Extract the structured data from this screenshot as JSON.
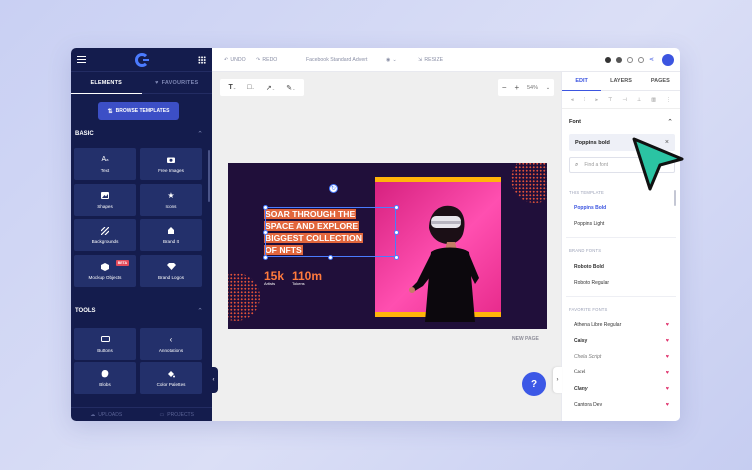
{
  "sidebar": {
    "tabs": {
      "elements": "ELEMENTS",
      "favourites": "FAVOURITES"
    },
    "browse_label": "BROWSE TEMPLATES",
    "basic": {
      "title": "BASIC",
      "items": [
        {
          "label": "Text",
          "icon": "text-icon"
        },
        {
          "label": "Free Images",
          "icon": "camera-icon"
        },
        {
          "label": "Shapes",
          "icon": "shapes-icon"
        },
        {
          "label": "Icons",
          "icon": "star-icon"
        },
        {
          "label": "Backgrounds",
          "icon": "backgrounds-icon"
        },
        {
          "label": "Brand It",
          "icon": "brand-icon"
        },
        {
          "label": "Mockup Objects",
          "icon": "mockup-icon",
          "badge": "BETA"
        },
        {
          "label": "Brand Logos",
          "icon": "diamond-icon"
        }
      ]
    },
    "tools": {
      "title": "TOOLS",
      "items": [
        {
          "label": "Buttons",
          "icon": "button-icon"
        },
        {
          "label": "Annotations",
          "icon": "annotation-icon"
        },
        {
          "label": "Blobs",
          "icon": "blob-icon"
        },
        {
          "label": "Color Palettes",
          "icon": "palette-icon"
        }
      ]
    },
    "bottom": {
      "uploads": "UPLOADS",
      "projects": "PROJECTS"
    }
  },
  "topbar": {
    "undo": "UNDO",
    "redo": "REDO",
    "doc_title": "Facebook Standard Advert",
    "resize": "RESIZE"
  },
  "toolbar": {
    "zoom": "54%"
  },
  "banner": {
    "headline": [
      "SOAR THROUGH THE",
      "SPACE AND EXPLORE",
      "BIGGEST COLLECTION",
      "OF NFTS"
    ],
    "stats": [
      {
        "value": "15k",
        "label": "Artists"
      },
      {
        "value": "110m",
        "label": "Tokens"
      }
    ]
  },
  "canvas": {
    "new_page": "NEW PAGE",
    "help": "?"
  },
  "right_panel": {
    "tabs": [
      "EDIT",
      "LAYERS",
      "PAGES"
    ],
    "font_section": "Font",
    "current_font": "Poppins bold",
    "search_placeholder": "Find a font",
    "this_template_label": "THIS TEMPLATE",
    "this_template_fonts": [
      "Poppins Bold",
      "Poppins Light"
    ],
    "brand_fonts_label": "BRAND FONTS",
    "brand_fonts": [
      "Roboto Bold",
      "Roboto Regular"
    ],
    "favorite_fonts_label": "FAVORITE FONTS",
    "favorite_fonts": [
      "Athena Libre Regular",
      "Caisy",
      "Chela Script",
      "Cacel",
      "Clany",
      "Cantora Dev"
    ]
  },
  "colors": {
    "sidebar": "#141c4d",
    "accent": "#3c55e0",
    "banner_bg": "#200f3a",
    "photo": "#e82c8d",
    "stat": "#ff7a3d",
    "pointer": "#2bc4a3"
  }
}
